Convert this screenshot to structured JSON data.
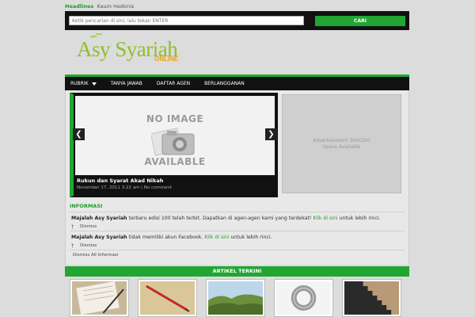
{
  "headline": {
    "label": "Headlines",
    "text": "Kaum Hedonis"
  },
  "search": {
    "placeholder": "Ketik pencarian di sini, lalu tekan ENTER",
    "button_label": "CARI"
  },
  "logo": {
    "main": "Asy Syariah",
    "sub": "ONLINE"
  },
  "nav": {
    "items": [
      {
        "label": "RUBRIK",
        "has_dropdown": true
      },
      {
        "label": "TANYA JAWAB"
      },
      {
        "label": "DAFTAR AGEN"
      },
      {
        "label": "BERLANGGANAN"
      }
    ]
  },
  "slider": {
    "placeholder_top": "NO IMAGE",
    "placeholder_bottom": "AVAILABLE",
    "prev": "❮",
    "next": "❯",
    "title": "Rukun dan Syarat Akad Nikah",
    "date": "November 17, 2011 3:22 am",
    "separator": " | ",
    "comments": "No comment"
  },
  "ad": {
    "line1": "Advertisement 300x250",
    "line2": "Space Available"
  },
  "info": {
    "title": "INFORMASI",
    "items": [
      {
        "bold": "Majalah Asy Syariah",
        "text": " terbaru edisi 100 telah terbit. Dapatkan di agen-agen kami yang terdekat! ",
        "link": "Klik di sini",
        "tail": " untuk lebih rinci.",
        "pin": "†",
        "dismiss": "Dismiss"
      },
      {
        "bold": "Majalah Asy Syariah",
        "text": " tidak memiliki akun Facebook. ",
        "link": "Klik di sini",
        "tail": " untuk lebih rinci.",
        "pin": "†",
        "dismiss": "Dismiss"
      }
    ],
    "dismiss_all": "Dismiss All Informasi"
  },
  "articles": {
    "title": "ARTIKEL TERKINI"
  },
  "colors": {
    "accent": "#21a633",
    "dark": "#111111",
    "logo_green": "#8fbf2c",
    "logo_orange": "#e8a317"
  }
}
